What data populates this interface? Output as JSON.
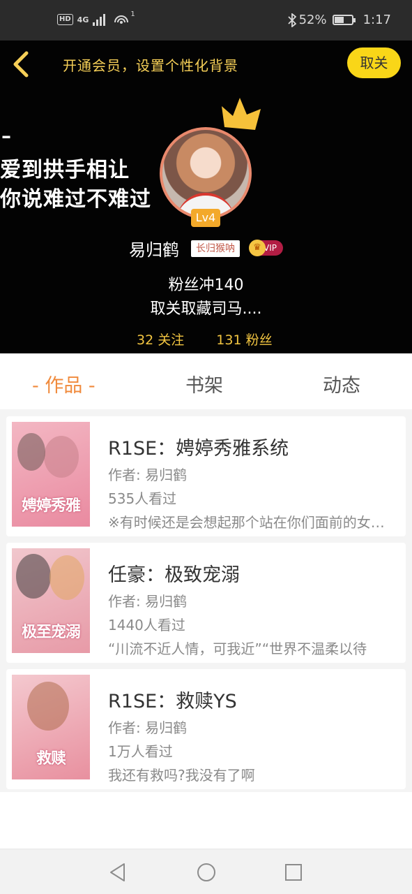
{
  "status_bar": {
    "hd": "HD",
    "network": "4G",
    "hotspot_count": "1",
    "battery_percent": "52%",
    "battery_level": 0.52,
    "time": "1:17"
  },
  "header": {
    "title": "开通会员，设置个性化背景",
    "unfollow_label": "取关"
  },
  "background_text": {
    "dash": "–",
    "line1": "爱到拱手相让",
    "line2": "你说难过不难过"
  },
  "profile": {
    "level": "Lv4",
    "username": "易归鹤",
    "name_badge": "长归猴呐",
    "vip": "VIP",
    "bio_line1": "粉丝冲140",
    "bio_line2": "取关取藏司马....",
    "following": "32 关注",
    "followers": "131 粉丝"
  },
  "tabs": [
    {
      "label": "- 作品 -",
      "active": true
    },
    {
      "label": "书架",
      "active": false
    },
    {
      "label": "动态",
      "active": false
    }
  ],
  "books": [
    {
      "title": "R1SE：娉婷秀雅系统",
      "author": "作者: 易归鹤",
      "views": "535人看过",
      "desc": "※有时候还是会想起那个站在你们面前的女孩……",
      "cover_text": "娉婷秀雅",
      "cover_colors": [
        "#f3b7c3",
        "#e98aa0"
      ]
    },
    {
      "title": "任豪：极致宠溺",
      "author": "作者: 易归鹤",
      "views": "1440人看过",
      "desc": "“川流不近人情，可我近”“世界不温柔以待",
      "cover_text": "极至宠溺",
      "cover_colors": [
        "#f1c7cd",
        "#e79aa7"
      ]
    },
    {
      "title": "R1SE：救赎YS",
      "author": "作者: 易归鹤",
      "views": "1万人看过",
      "desc": "我还有救吗?我没有了啊",
      "cover_text": "救赎",
      "cover_colors": [
        "#f4c9cf",
        "#e8909f"
      ]
    }
  ]
}
